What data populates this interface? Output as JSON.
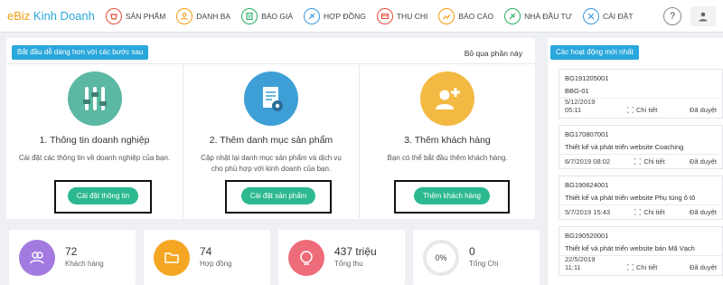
{
  "nav": {
    "logo_part1": "eBiz",
    "logo_part2": "Kinh Doanh",
    "items": [
      {
        "label": "SẢN PHẨM",
        "icon": "product-icon",
        "color": "#e74c3c"
      },
      {
        "label": "DANH BẠ",
        "icon": "contacts-icon",
        "color": "#f39c12"
      },
      {
        "label": "BÁO GIÁ",
        "icon": "quote-icon",
        "color": "#27ae60"
      },
      {
        "label": "HỢP ĐỒNG",
        "icon": "contract-icon",
        "color": "#3498db"
      },
      {
        "label": "THU CHI",
        "icon": "income-expense-icon",
        "color": "#e74c3c"
      },
      {
        "label": "BÁO CÁO",
        "icon": "report-icon",
        "color": "#f39c12"
      },
      {
        "label": "NHÀ ĐẦU TƯ",
        "icon": "investor-icon",
        "color": "#27ae60"
      },
      {
        "label": "CÀI ĐẶT",
        "icon": "settings-icon",
        "color": "#3498db"
      }
    ],
    "help_label": "?"
  },
  "onboarding": {
    "title": "Bắt đầu dễ dàng hơn với các bước sau",
    "skip": "Bỏ qua phần này",
    "steps": [
      {
        "title": "1. Thông tin doanh nghiệp",
        "desc": "Cài đặt các thông tin về doanh nghiệp của bạn.",
        "button": "Cài đặt thông tin",
        "icon": "sliders-icon",
        "color": "#5bb8a2"
      },
      {
        "title": "2. Thêm danh mục sản phẩm",
        "desc": "Cập nhật lại danh mục sản phẩm và dịch vụ cho phù hợp với kinh doanh của bạn.",
        "button": "Cài đặt sản phẩm",
        "icon": "document-gear-icon",
        "color": "#3d9fd6"
      },
      {
        "title": "3. Thêm khách hàng",
        "desc": "Bạn có thể bắt đầu thêm khách hàng.",
        "button": "Thêm khách hàng",
        "icon": "add-user-icon",
        "color": "#f4b942"
      }
    ]
  },
  "stats": [
    {
      "value": "72",
      "label": "Khách hàng",
      "color": "#a37be0",
      "icon": "customers-icon"
    },
    {
      "value": "74",
      "label": "Hợp đồng",
      "color": "#f5a623",
      "icon": "folder-icon"
    },
    {
      "value": "437 triệu",
      "label": "Tổng thu",
      "color": "#ee6b7a",
      "icon": "income-icon"
    },
    {
      "value": "0",
      "label": "Tổng Chi",
      "percent": "0%",
      "icon": "expense-gauge"
    }
  ],
  "activity": {
    "title": "Các hoạt động mới nhất",
    "items": [
      {
        "code": "BG191205001",
        "desc": "BBG-01",
        "date1": "5/12/2019",
        "date2": "05:11",
        "detail": "Chi tiết",
        "status": "Đã duyệt"
      },
      {
        "code": "BG170807001",
        "desc": "Thiết kế và phát triển website Coaching",
        "date1": "6/7/2019 08:02",
        "date2": "",
        "detail": "Chi tiết",
        "status": "Đã duyệt"
      },
      {
        "code": "BG190624001",
        "desc": "Thiết kế và phát triển website Phụ tùng ô tô",
        "date1": "5/7/2019 15:43",
        "date2": "",
        "detail": "Chi tiết",
        "status": "Đã duyệt"
      },
      {
        "code": "BG190520001",
        "desc": "Thiết kế và phát triển website bán Mã Vạch",
        "date1": "22/5/2019",
        "date2": "11:11",
        "detail": "Chi tiết",
        "status": "Đã duyệt"
      }
    ]
  }
}
